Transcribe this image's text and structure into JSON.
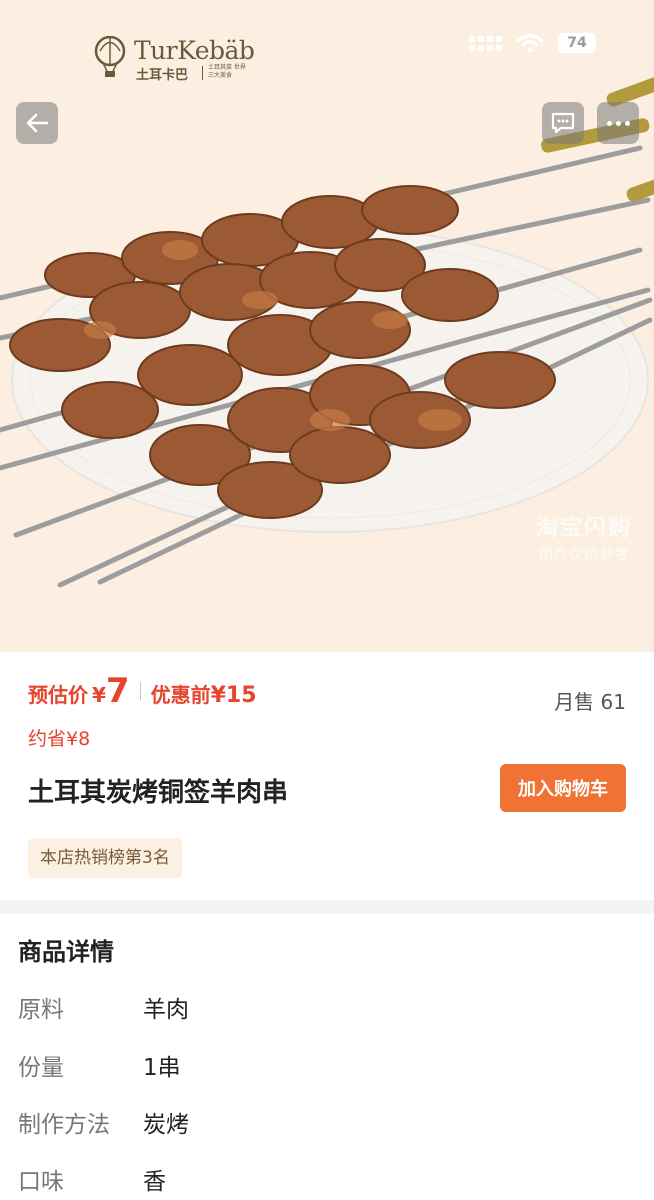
{
  "hero": {
    "brand_en": "TurKebäb",
    "brand_cn": "土耳卡巴",
    "brand_tag": "土耳其菜 世界三大美食",
    "battery": "74",
    "watermark_line1": "淘宝闪购",
    "watermark_line2": "图片仅供参考",
    "icons": [
      "back-arrow-icon",
      "message-icon",
      "more-dots-icon",
      "wifi-icon",
      "hot-air-balloon-icon"
    ]
  },
  "product": {
    "price_label": "预估价",
    "currency": "¥",
    "price": "7",
    "original_label": "优惠前",
    "original_price": "¥15",
    "saving": "约省¥8",
    "monthly_sales": "月售 61",
    "title": "土耳其炭烤铜签羊肉串",
    "add_to_cart": "加入购物车",
    "rank_badge": "本店热销榜第3名"
  },
  "details": {
    "title": "商品详情",
    "specs": [
      {
        "label": "原料",
        "value": "羊肉"
      },
      {
        "label": "份量",
        "value": "1串"
      },
      {
        "label": "制作方法",
        "value": "炭烤"
      },
      {
        "label": "口味",
        "value": "香"
      }
    ]
  },
  "colors": {
    "accent": "#e8432e",
    "button": "#f07234",
    "hero_bg": "#fcefe2",
    "badge_bg": "#fcf0e2"
  }
}
